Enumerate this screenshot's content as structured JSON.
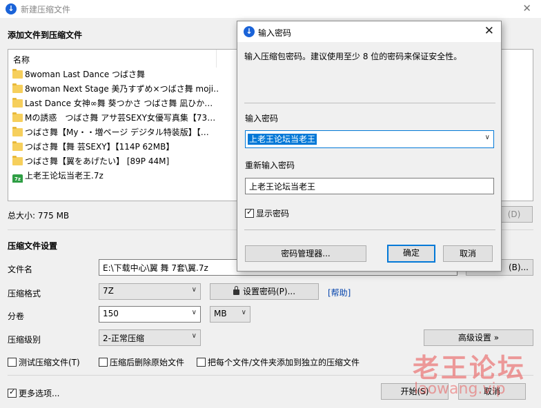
{
  "window": {
    "title": "新建压缩文件",
    "close_glyph": "✕",
    "logo_glyph": "↓"
  },
  "add_section": {
    "heading": "添加文件到压缩文件"
  },
  "file_list": {
    "column_header": "名称",
    "items": [
      {
        "name": "8woman Last Dance つばさ舞",
        "type": "folder"
      },
      {
        "name": "8woman Next Stage 美乃すずめ×つばさ舞 moji…",
        "type": "folder"
      },
      {
        "name": "Last Dance 女神∞舞 葵つかさ つばさ舞 凪ひか…",
        "type": "folder"
      },
      {
        "name": "Mの誘惑　つばさ舞 アサ芸SEXY女優写真集【73…",
        "type": "folder"
      },
      {
        "name": "つばさ舞【My・・増ページ デジタル特装版】【…",
        "type": "folder"
      },
      {
        "name": "つばさ舞【舞 芸SEXY】【114P 62MB】",
        "type": "folder"
      },
      {
        "name": "つばさ舞【翼をあげたい】 [89P 44M]",
        "type": "folder"
      },
      {
        "name": "上老王论坛当老王.7z",
        "type": "archive",
        "icon_text": "7z"
      }
    ]
  },
  "total_size": "总大小: 775 MB",
  "hidden_button": "(D)",
  "settings": {
    "heading": "压缩文件设置",
    "filename_label": "文件名",
    "filename_value": "E:\\下载中心\\翼 舞 7套\\翼.7z",
    "browse_button": "(B)...",
    "format_label": "压缩格式",
    "format_value": "7Z",
    "set_password_button": "设置密码(P)...",
    "help_link": "[帮助]",
    "split_label": "分卷",
    "split_value": "150",
    "split_unit": "MB",
    "level_label": "压缩级别",
    "level_value": "2-正常压缩",
    "advanced_button": "高级设置 »",
    "test_checkbox": "测试压缩文件(T)",
    "delete_checkbox": "压缩后删除原始文件",
    "separate_checkbox": "把每个文件/文件夹添加到独立的压缩文件",
    "more_options_checkbox": "更多选项...",
    "start_button": "开始(S)",
    "cancel_button": "取消"
  },
  "watermark": {
    "cn": "老王论坛",
    "en": "laowang.vip"
  },
  "dialog": {
    "title": "输入密码",
    "close_glyph": "✕",
    "description": "输入压缩包密码。建议使用至少 8 位的密码来保证安全性。",
    "password_label": "输入密码",
    "password_value": "上老王论坛当老王",
    "reenter_label": "重新输入密码",
    "reenter_value": "上老王论坛当老王",
    "show_password_checkbox": "显示密码",
    "manager_button": "密码管理器...",
    "ok_button": "确定",
    "cancel_button": "取消"
  }
}
